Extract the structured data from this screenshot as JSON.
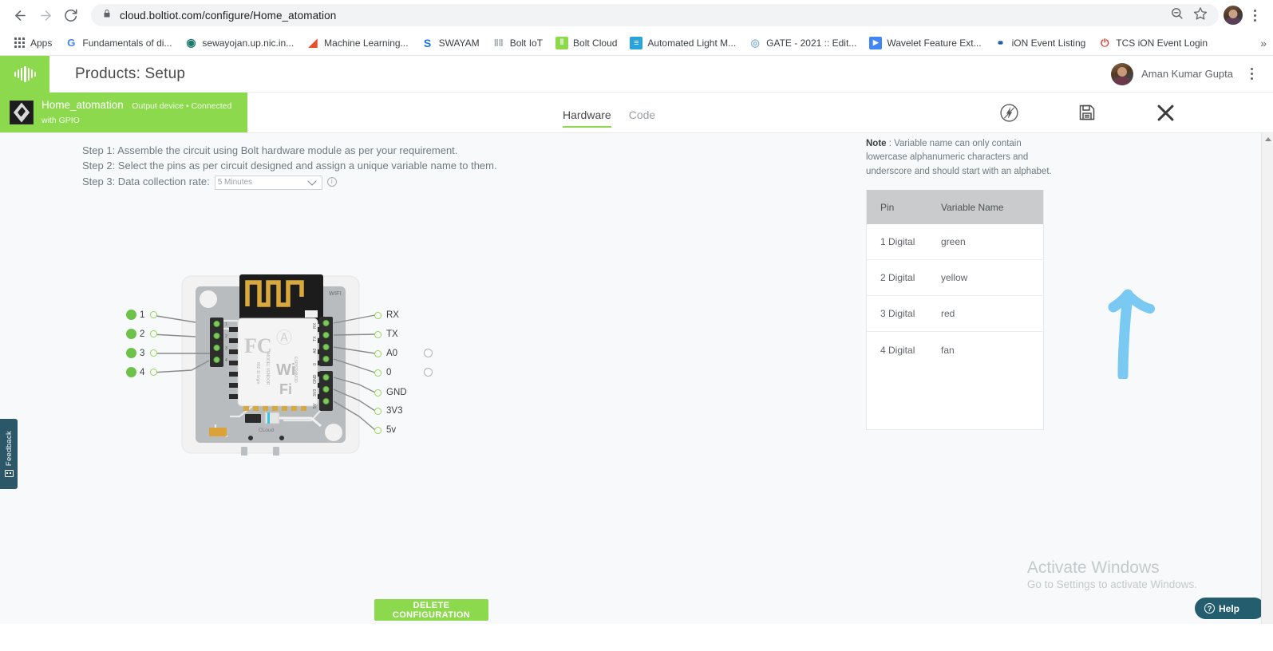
{
  "browser": {
    "url": "cloud.boltiot.com/configure/Home_atomation",
    "back_icon": "back-arrow-icon",
    "forward_icon": "forward-arrow-icon",
    "reload_icon": "reload-icon",
    "lock_icon": "lock-icon",
    "zoom_icon": "zoom-out-icon",
    "star_icon": "star-icon",
    "menu_icon": "kebab-menu-icon",
    "bookmarks": [
      {
        "label": "Apps",
        "favicon": "apps-grid-icon",
        "color": "#5f6368"
      },
      {
        "label": "Fundamentals of di...",
        "favicon": "google-g-icon",
        "color": "#4285f4",
        "glyph": "G"
      },
      {
        "label": "sewayojan.up.nic.in...",
        "favicon": "globe-icon",
        "color": "#2a9d8f",
        "glyph": "◉"
      },
      {
        "label": "Machine Learning...",
        "favicon": "matlab-icon",
        "color": "#e8502a",
        "glyph": "◢"
      },
      {
        "label": "SWAYAM",
        "favicon": "swayam-s-icon",
        "color": "#1a73e8",
        "glyph": "S"
      },
      {
        "label": "Bolt IoT",
        "favicon": "bolt-wave-icon",
        "color": "#9aa0a6",
        "glyph": "‖"
      },
      {
        "label": "Bolt Cloud",
        "favicon": "bolt-cloud-icon",
        "color": "#8cd94e",
        "glyph": "‖"
      },
      {
        "label": "Automated Light M...",
        "favicon": "sheets-icon",
        "color": "#34a853",
        "glyph": "≡"
      },
      {
        "label": "GATE - 2021 :: Edit...",
        "favicon": "gate-icon",
        "color": "#8ab4d8",
        "glyph": "◎"
      },
      {
        "label": "Wavelet Feature Ext...",
        "favicon": "pdf-icon",
        "color": "#4285f4",
        "glyph": "▶"
      },
      {
        "label": "iON Event Listing",
        "favicon": "tata-icon",
        "color": "#1e5aa8",
        "glyph": "⛭"
      },
      {
        "label": "TCS iON Event Login",
        "favicon": "power-icon",
        "color": "#e03c31",
        "glyph": "⏻"
      }
    ],
    "overflow_label": "»"
  },
  "app_header": {
    "logo_name": "bolt-logo",
    "title": "Products: Setup",
    "user_name": "Aman Kumar Gupta",
    "menu_icon": "vertical-dots-icon"
  },
  "device": {
    "name": "Home_atomation",
    "meta": "Output device • Connected with GPIO",
    "thumb_icon": "device-thumbnail"
  },
  "tabs": [
    {
      "label": "Hardware",
      "active": true
    },
    {
      "label": "Code",
      "active": false
    }
  ],
  "toolbar": {
    "energy_icon": "bolt-circle-icon",
    "save_icon": "save-floppy-icon",
    "close_icon": "close-x-icon"
  },
  "steps": {
    "step1": "Step 1: Assemble the circuit using Bolt hardware module as per your requirement.",
    "step2": "Step 2: Select the pins as per circuit designed and assign a unique variable name to them.",
    "step3_label": "Step 3: Data collection rate:",
    "rate_value": "5 Minutes",
    "rate_options": [
      "5 Minutes"
    ],
    "info_icon": "info-icon"
  },
  "board": {
    "wifi_label": "WIFI",
    "cloud_label": "CLoud",
    "chip_fcc": "FC",
    "chip_brand": "Wi Fi",
    "left_pins": [
      {
        "num": "1",
        "selected": true
      },
      {
        "num": "2",
        "selected": true
      },
      {
        "num": "3",
        "selected": true
      },
      {
        "num": "4",
        "selected": true
      }
    ],
    "right_pins": [
      {
        "label": "RX",
        "extra_radio": false
      },
      {
        "label": "TX",
        "extra_radio": false
      },
      {
        "label": "A0",
        "extra_radio": true
      },
      {
        "label": "0",
        "extra_radio": true
      },
      {
        "label": "GND",
        "extra_radio": false
      },
      {
        "label": "3V3",
        "extra_radio": false
      },
      {
        "label": "5v",
        "extra_radio": false
      }
    ],
    "inner_side_labels": [
      "RX",
      "TX",
      "A0",
      "0",
      "GND",
      "3V3",
      "5V"
    ]
  },
  "delete_button": "DELETE CONFIGURATION",
  "note": {
    "bold": "Note",
    "text": " : Variable name can only contain lowercase alphanumeric characters and underscore and should start with an alphabet."
  },
  "table": {
    "columns": [
      "Pin",
      "Variable Name"
    ],
    "rows": [
      {
        "pin": "1 Digital",
        "variable": "green"
      },
      {
        "pin": "2 Digital",
        "variable": "yellow"
      },
      {
        "pin": "3 Digital",
        "variable": "red"
      },
      {
        "pin": "4 Digital",
        "variable": "fan"
      }
    ]
  },
  "annotation": {
    "arrow_icon": "hand-drawn-up-arrow",
    "color": "#79c9f2"
  },
  "activate_windows": {
    "line1": "Activate Windows",
    "line2": "Go to Settings to activate Windows."
  },
  "help_widget": {
    "label": "Help",
    "icon": "question-mark-icon"
  },
  "feedback_tab": {
    "label": "Feedback",
    "icon": "feedback-icon"
  },
  "colors": {
    "brand_green": "#8cd94e",
    "accent_blue": "#79c9f2",
    "teal": "#245e6e"
  }
}
